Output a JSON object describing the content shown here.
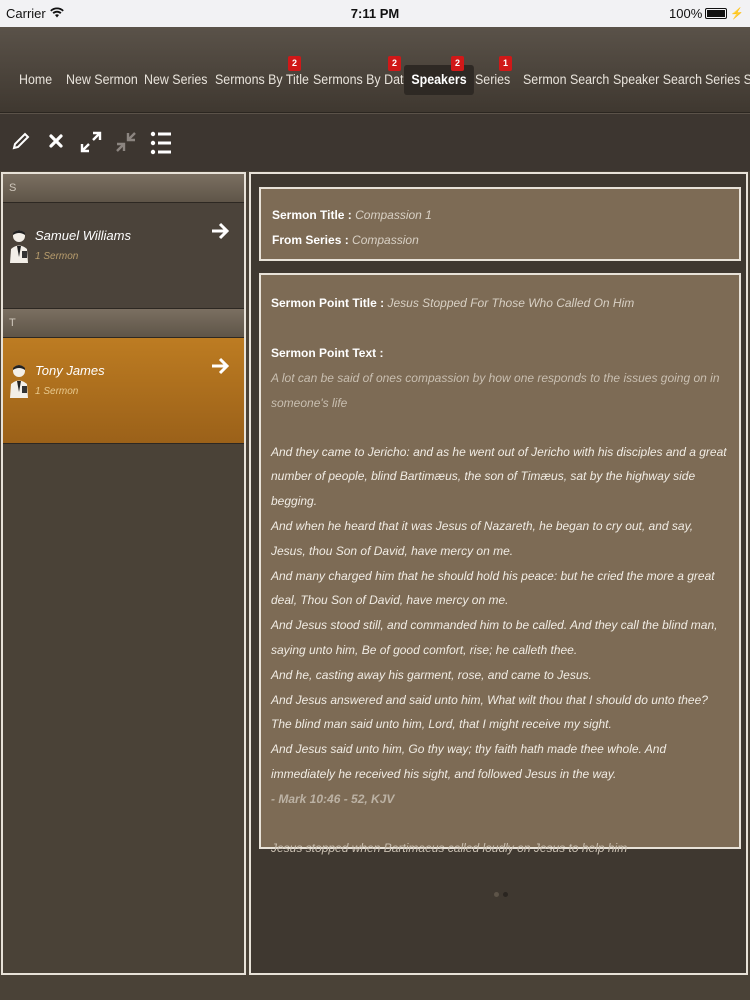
{
  "status": {
    "carrier": "Carrier",
    "time": "7:11 PM",
    "battery": "100%"
  },
  "tabs": [
    {
      "label": "Home"
    },
    {
      "label": "New Sermon"
    },
    {
      "label": "New Series"
    },
    {
      "label": "Sermons By Title",
      "badge": "2"
    },
    {
      "label": "Sermons By Date",
      "badge": "2"
    },
    {
      "label": "Speakers",
      "badge": "2",
      "active": true
    },
    {
      "label": "Series",
      "badge": "1"
    },
    {
      "label": "Sermon Search"
    },
    {
      "label": "Speaker Search"
    },
    {
      "label": "Series S"
    }
  ],
  "toolbar": {
    "icons": [
      "pencil-icon",
      "close-icon",
      "expand-icon",
      "collapse-icon",
      "list-icon"
    ]
  },
  "speakers": {
    "sections": [
      {
        "letter": "S",
        "items": [
          {
            "name": "Samuel Williams",
            "count": "1 Sermon",
            "selected": false
          }
        ]
      },
      {
        "letter": "T",
        "items": [
          {
            "name": "Tony James",
            "count": "1 Sermon",
            "selected": true
          }
        ]
      }
    ]
  },
  "detail": {
    "title_label": "Sermon Title :",
    "title_value": "Compassion 1",
    "series_label": "From Series :",
    "series_value": "Compassion",
    "point_title_label": "Sermon Point Title :",
    "point_title_value": "Jesus Stopped For Those Who Called On Him",
    "point_text_label": "Sermon Point Text :",
    "intro": "A lot can be said of ones compassion by how one responds to the issues going on in someone's life",
    "verses": [
      "And they came to Jericho: and as he went out of Jericho with his disciples and a great number of people, blind Bartimæus, the son of Timæus, sat by the highway side begging.",
      "And when he heard that it was Jesus of Nazareth, he began to cry out, and say, Jesus, thou Son of David, have mercy on me.",
      "And many charged him that he should hold his peace: but he cried the more a great deal, Thou Son of David, have mercy on me.",
      "And Jesus stood still, and commanded him to be called. And they call the blind man, saying unto him, Be of good comfort, rise; he calleth thee.",
      "And he, casting away his garment, rose, and came to Jesus.",
      "And Jesus answered and said unto him, What wilt thou that I should do unto thee? The blind man said unto him, Lord, that I might receive my sight.",
      "And Jesus said unto him, Go thy way; thy faith hath made thee whole. And immediately he received his sight, and followed Jesus in the way."
    ],
    "reference": "- Mark 10:46 - 52, KJV",
    "closing": "Jesus stopped when Bartimaeus called loudly on Jesus to help him"
  },
  "pager": {
    "pages": 2,
    "current": 2
  }
}
